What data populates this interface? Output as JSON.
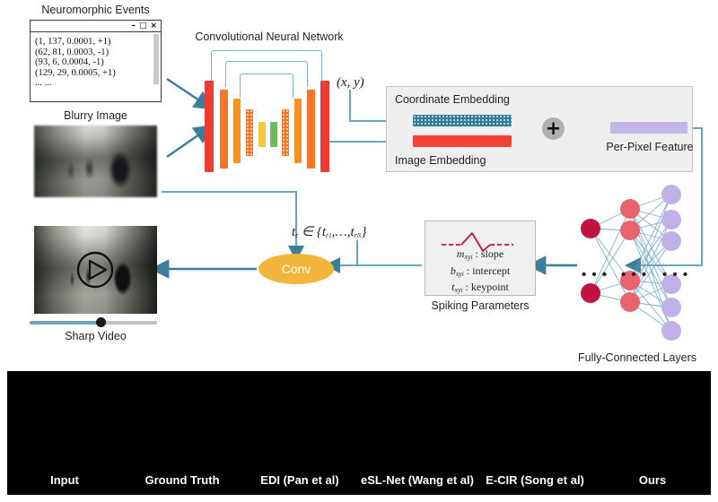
{
  "figure": {
    "events_window": {
      "title_buttons": [
        "minimize-icon",
        "maximize-icon",
        "close-icon"
      ],
      "minimize": "–",
      "maximize": "□",
      "close": "×",
      "caption": "Neuromorphic Events",
      "events_text": "(1, 137, 0.0001, +1)\n(62, 81, 0.0003, -1)\n(93, 6, 0.0004, -1)\n(129, 29, 0.0005, +1)\n... ..."
    },
    "blurry_image": {
      "caption": "Blurry Image"
    },
    "sharp_video": {
      "caption": "Sharp Video",
      "progress_percent": 55
    },
    "cnn": {
      "title": "Convolutional Neural Network"
    },
    "coordinate_input": {
      "label": "(x, y)"
    },
    "embedding_panel": {
      "coordinate_embedding": "Coordinate Embedding",
      "image_embedding": "Image Embedding",
      "per_pixel_feature": "Per-Pixel Feature",
      "operator": "+"
    },
    "fully_connected": {
      "caption": "Fully-Connected Layers",
      "ellipsis": "• • •"
    },
    "spiking": {
      "caption": "Spiking Parameters",
      "rows": [
        {
          "symbol": "m",
          "subscript": "xy",
          "index": "i",
          "desc": ": slope"
        },
        {
          "symbol": "b",
          "subscript": "xy",
          "index": "i",
          "desc": ": intercept"
        },
        {
          "symbol": "t",
          "subscript": "xy",
          "index": "i",
          "desc": ": keypoint"
        }
      ]
    },
    "conv": {
      "label": "Conv"
    },
    "timestamp_formula": {
      "label": "t_r ∈ {t_r1, …, t_rN}"
    }
  },
  "comparison": {
    "panels": [
      {
        "label": "Input"
      },
      {
        "label": "Ground Truth"
      },
      {
        "label": "EDI (Pan et al)"
      },
      {
        "label": "eSL-Net (Wang et al)"
      },
      {
        "label": "E-CIR (Song et al)"
      },
      {
        "label": "Ours"
      }
    ]
  },
  "colors": {
    "arrow_teal": "#3a7f9b",
    "connector_blue": "#7fb2cc",
    "bar_red": "#ee3b33",
    "bar_orange": "#f4762a",
    "bar_amber": "#f79320",
    "bar_yellow": "#f5c63c",
    "bar_green": "#72b95a",
    "coord_embed_teal": "#2e7e9e",
    "image_embed_red": "#f44336",
    "per_pixel_lavender": "#c5b6ea",
    "fc_dark_red": "#c2123f",
    "fc_salmon": "#e8636b",
    "fc_lavender": "#c0b0e8",
    "conv_amber": "#f2b63c",
    "spike_crimson": "#c8103c"
  }
}
